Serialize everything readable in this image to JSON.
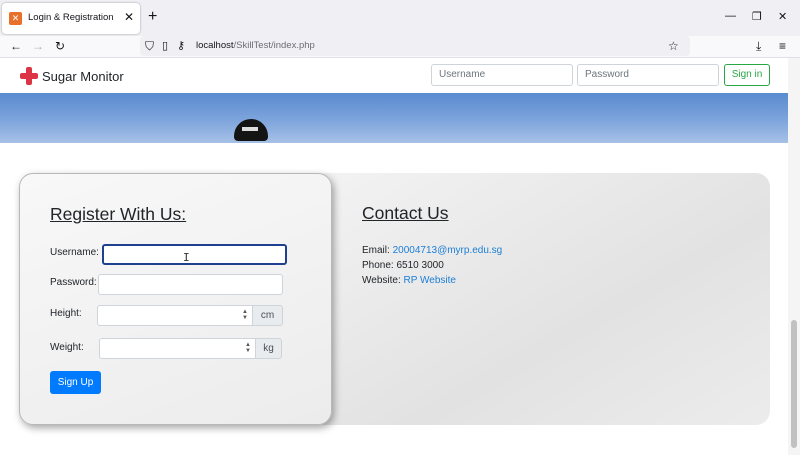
{
  "browser": {
    "tab_title": "Login & Registration",
    "tab_favicon": "xampp-favicon-icon",
    "url_host": "localhost",
    "url_path": "/SkillTest/index.php"
  },
  "site": {
    "brand_name": "Sugar Monitor",
    "username_placeholder": "Username",
    "password_placeholder": "Password",
    "signin_label": "Sign in",
    "accent_colors": {
      "signin": "#28a745",
      "signup": "#007bff",
      "link": "#1c7ed6",
      "brand": "#dc3545"
    }
  },
  "register": {
    "title": "Register With Us:",
    "username_label": "Username:",
    "password_label": "Password:",
    "height_label": "Height:",
    "height_unit": "cm",
    "weight_label": "Weight:",
    "weight_unit": "kg",
    "signup_label": "Sign Up"
  },
  "contact": {
    "title": "Contact Us",
    "email_label": "Email:",
    "email_value": "20004713@myrp.edu.sg",
    "phone_label": "Phone:",
    "phone_value": "6510 3000",
    "website_label": "Website:",
    "website_value": "RP Website"
  }
}
